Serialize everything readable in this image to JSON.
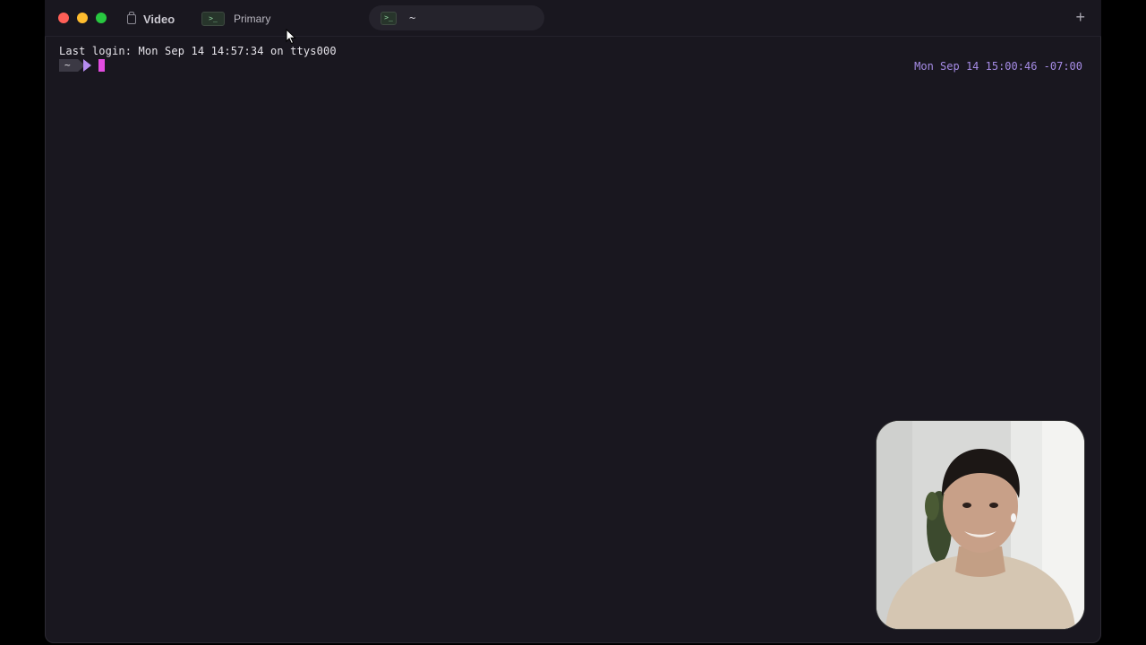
{
  "window": {
    "space_label": "Video",
    "tabs": [
      {
        "label": "Primary"
      },
      {
        "label": "~"
      }
    ],
    "new_tab_glyph": "+"
  },
  "terminal": {
    "login_line": "Last login: Mon Sep 14 14:57:34 on ttys000",
    "prompt_dir": "~",
    "timestamp": "Mon Sep 14 15:00:46 -07:00"
  },
  "icons": {
    "space": "folder-icon",
    "terminal": "terminal-icon",
    "cursor": "mouse-pointer-icon"
  },
  "colors": {
    "background": "#19171f",
    "accent_purple": "#b58cf0",
    "cursor_pink": "#e24ce0",
    "timestamp": "#a68ce6"
  }
}
